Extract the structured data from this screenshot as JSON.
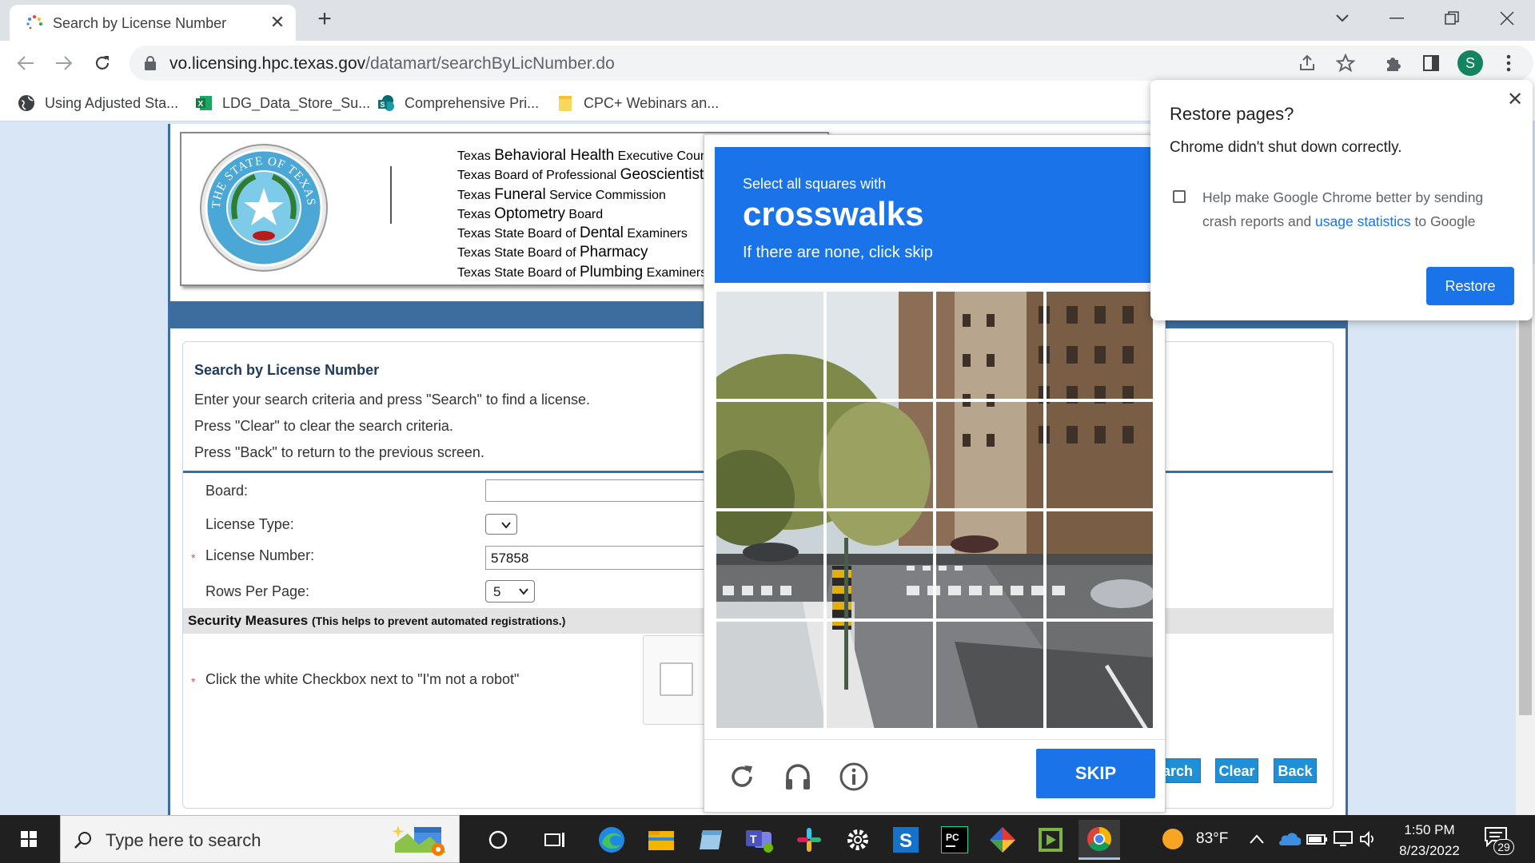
{
  "browser": {
    "tab_title": "Search by License Number",
    "new_tab_label": "+",
    "url_host": "vo.licensing.hpc.texas.gov",
    "url_path": "/datamart/searchByLicNumber.do",
    "profile_initial": "S",
    "bookmarks": [
      {
        "label": "Using Adjusted Sta...",
        "icon": "globe-icon"
      },
      {
        "label": "LDG_Data_Store_Su...",
        "icon": "excel-icon"
      },
      {
        "label": "Comprehensive Pri...",
        "icon": "sharepoint-icon"
      },
      {
        "label": "CPC+ Webinars an...",
        "icon": "folder-icon"
      }
    ]
  },
  "header": {
    "seal_text": "THE STATE OF TEXAS",
    "boards": [
      {
        "prefix": "Texas ",
        "strong": "Behavioral Health",
        "suffix": " Executive Council"
      },
      {
        "prefix": "Texas Board of Professional ",
        "strong": "Geoscientists",
        "suffix": ""
      },
      {
        "prefix": "Texas ",
        "strong": "Funeral",
        "suffix": " Service Commission"
      },
      {
        "prefix": "Texas ",
        "strong": "Optometry",
        "suffix": " Board"
      },
      {
        "prefix": "Texas State Board of ",
        "strong": "Dental",
        "suffix": " Examiners"
      },
      {
        "prefix": "Texas State Board of ",
        "strong": "Pharmacy",
        "suffix": ""
      },
      {
        "prefix": "Texas State Board of ",
        "strong": "Plumbing",
        "suffix": " Examiners"
      }
    ]
  },
  "search": {
    "title": "Search by License Number",
    "instructions": [
      "Enter your search criteria and press \"Search\" to find a license.",
      "Press \"Clear\" to clear the search criteria.",
      "Press \"Back\" to return to the previous screen."
    ],
    "board_label": "Board:",
    "board_value": "",
    "license_type_label": "License Type:",
    "license_number_label": "License Number:",
    "license_number_value": "57858",
    "rows_label": "Rows Per Page:",
    "rows_value": "5",
    "required_mark": "*",
    "security_title": "Security Measures",
    "security_note": "(This helps to prevent automated registrations.)",
    "robot_instruction": "Click the white Checkbox next to \"I'm not a robot\"",
    "buttons": {
      "search": "arch",
      "clear": "Clear",
      "back": "Back"
    }
  },
  "captcha": {
    "prompt_small": "Select all squares with",
    "prompt_target": "crosswalks",
    "prompt_hint": "If there are none, click skip",
    "skip_label": "SKIP",
    "footer_icons": [
      "reload-icon",
      "audio-icon",
      "info-icon"
    ]
  },
  "restore_popup": {
    "title": "Restore pages?",
    "message": "Chrome didn't shut down correctly.",
    "option_text_1": "Help make Google Chrome better by sending crash reports and ",
    "option_link": "usage statistics",
    "option_text_2": " to Google",
    "checked": false,
    "button_label": "Restore"
  },
  "taskbar": {
    "search_placeholder": "Type here to search",
    "weather": "83°F",
    "time": "1:50 PM",
    "date": "8/23/2022",
    "notification_count": "29",
    "apps": [
      "cortana-icon",
      "task-view-icon",
      "edge-icon",
      "file-explorer-icon",
      "notes-icon",
      "teams-icon",
      "slack-icon",
      "settings-icon",
      "sharepoint-icon",
      "pycharm-icon",
      "git-icon",
      "media-player-icon",
      "chrome-icon"
    ]
  },
  "colors": {
    "chrome_frame": "#dee1e6",
    "page_blue": "#3d6d9e",
    "captcha_blue": "#1a73e8",
    "page_button": "#1f8fd6",
    "taskbar": "#202020"
  }
}
